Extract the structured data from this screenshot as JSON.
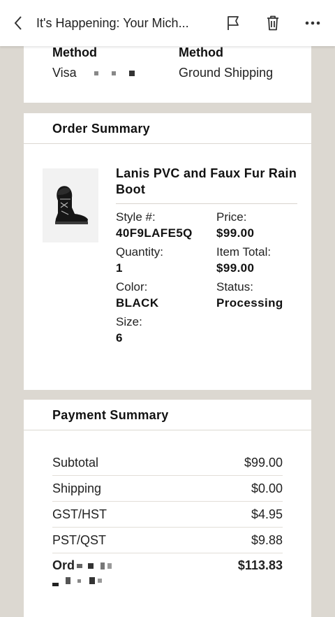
{
  "header": {
    "title": "It's Happening: Your Mich...",
    "back_icon": "chevron-left-icon",
    "flag_icon": "flag-icon",
    "delete_icon": "trash-icon",
    "more_icon": "more-icon"
  },
  "method": {
    "payment_label": "Method",
    "payment_value": "Visa",
    "shipping_label": "Method",
    "shipping_value": "Ground Shipping"
  },
  "order": {
    "heading": "Order Summary",
    "product_name": "Lanis PVC and Faux Fur Rain Boot",
    "style_label": "Style #:",
    "style_value": "40F9LAFE5Q",
    "quantity_label": "Quantity:",
    "quantity_value": "1",
    "color_label": "Color:",
    "color_value": "BLACK",
    "size_label": "Size:",
    "size_value": "6",
    "price_label": "Price:",
    "price_value": "$99.00",
    "item_total_label": "Item Total:",
    "item_total_value": "$99.00",
    "status_label": "Status:",
    "status_value": "Processing"
  },
  "payment": {
    "heading": "Payment Summary",
    "rows": [
      {
        "label": "Subtotal",
        "value": "$99.00"
      },
      {
        "label": "Shipping",
        "value": "$0.00"
      },
      {
        "label": "GST/HST",
        "value": "$4.95"
      },
      {
        "label": "PST/QST",
        "value": "$9.88"
      }
    ],
    "total_label": "Ord",
    "total_value": "$113.83"
  }
}
